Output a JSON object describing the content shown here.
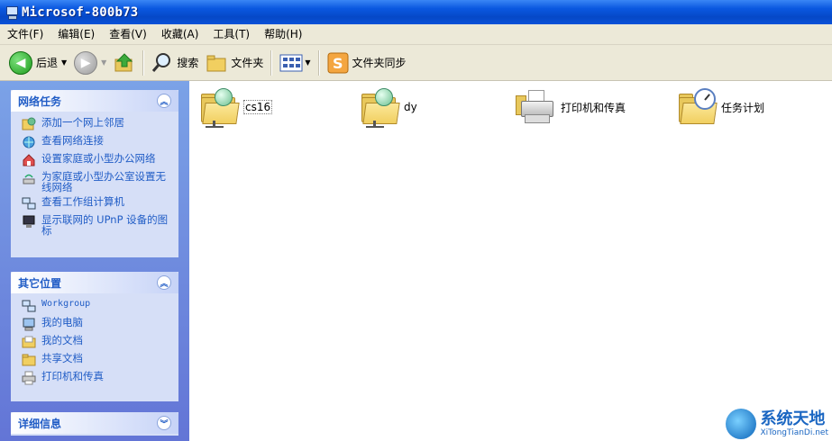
{
  "window": {
    "title": "Microsof-800b73"
  },
  "menu": [
    {
      "label": "文件(F)"
    },
    {
      "label": "编辑(E)"
    },
    {
      "label": "查看(V)"
    },
    {
      "label": "收藏(A)"
    },
    {
      "label": "工具(T)"
    },
    {
      "label": "帮助(H)"
    }
  ],
  "toolbar": {
    "back": "后退",
    "search": "搜索",
    "folders": "文件夹",
    "sync": "文件夹同步"
  },
  "network_tasks": {
    "title": "网络任务",
    "items": [
      {
        "label": "添加一个网上邻居"
      },
      {
        "label": "查看网络连接"
      },
      {
        "label": "设置家庭或小型办公网络"
      },
      {
        "label": "为家庭或小型办公室设置无线网络"
      },
      {
        "label": "查看工作组计算机"
      },
      {
        "label": "显示联网的 UPnP 设备的图标"
      }
    ]
  },
  "other_places": {
    "title": "其它位置",
    "items": [
      {
        "label": "Workgroup"
      },
      {
        "label": "我的电脑"
      },
      {
        "label": "我的文档"
      },
      {
        "label": "共享文档"
      },
      {
        "label": "打印机和传真"
      }
    ]
  },
  "details": {
    "title": "详细信息"
  },
  "content_items": [
    {
      "label": "cs16",
      "icon": "network-share-folder-icon"
    },
    {
      "label": "dy",
      "icon": "network-share-folder-icon"
    },
    {
      "label": "打印机和传真",
      "icon": "printer-icon"
    },
    {
      "label": "任务计划",
      "icon": "scheduled-tasks-icon"
    }
  ],
  "watermark": {
    "title": "系统天地",
    "url": "XiTongTianDi.net"
  }
}
